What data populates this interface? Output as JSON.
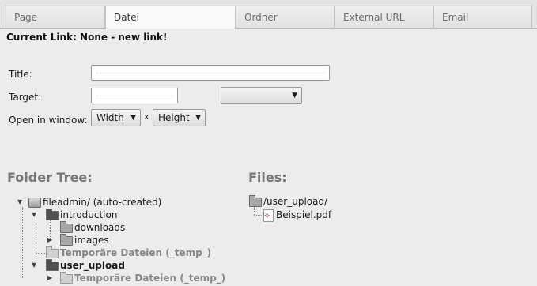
{
  "tabs": [
    "Page",
    "Datei",
    "Ordner",
    "External URL",
    "Email"
  ],
  "current_link": "Current Link: None - new link!",
  "form": {
    "title_label": "Title:",
    "target_label": "Target:",
    "window_label": "Open in window:",
    "width_select": "Width",
    "times": "x",
    "height_select": "Height"
  },
  "folder_tree": {
    "heading": "Folder Tree:",
    "nodes": [
      "fileadmin/ (auto-created)",
      "introduction",
      "downloads",
      "images",
      "Temporäre Dateien (_temp_)",
      "user_upload",
      "Temporäre Dateien (_temp_)"
    ]
  },
  "files": {
    "heading": "Files:",
    "folder": "/user_upload/",
    "file": "Beispiel.pdf"
  }
}
